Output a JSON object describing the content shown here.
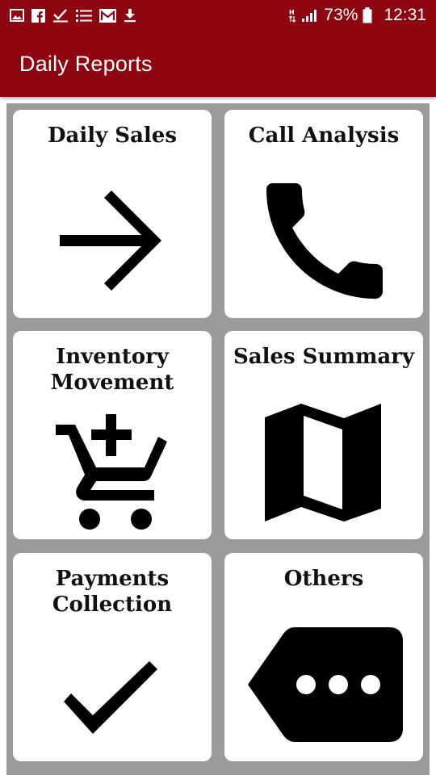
{
  "status_bar": {
    "icons": [
      "image-icon",
      "facebook-icon",
      "checklist-icon",
      "list-icon",
      "gmail-icon",
      "download-icon",
      "hd-icon",
      "signal-icon",
      "battery-icon"
    ],
    "battery": "73%",
    "time": "12:31"
  },
  "app_bar": {
    "title": "Daily Reports",
    "color": "#8e0710"
  },
  "cards": [
    {
      "label": "Daily Sales",
      "icon": "arrow-right-icon"
    },
    {
      "label": "Call Analysis",
      "icon": "phone-icon"
    },
    {
      "label": "Inventory\nMovement",
      "icon": "cart-add-icon"
    },
    {
      "label": "Sales Summary",
      "icon": "map-icon"
    },
    {
      "label": "Payments\nCollection",
      "icon": "check-icon"
    },
    {
      "label": "Others",
      "icon": "more-tag-icon"
    }
  ]
}
